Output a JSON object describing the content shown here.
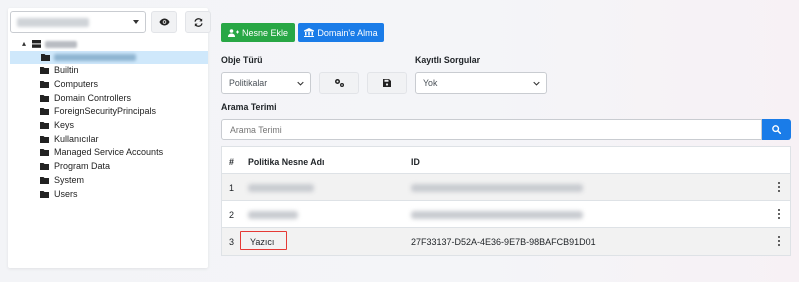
{
  "left_panel": {
    "tree": {
      "items": [
        "Builtin",
        "Computers",
        "Domain Controllers",
        "ForeignSecurityPrincipals",
        "Keys",
        "Kullanıcılar",
        "Managed Service Accounts",
        "Program Data",
        "System",
        "Users"
      ]
    }
  },
  "toolbar": {
    "add_object_label": "Nesne Ekle",
    "domain_label": "Domain'e Alma"
  },
  "filters": {
    "object_type_label": "Obje Türü",
    "object_type_value": "Politikalar",
    "saved_queries_label": "Kayıtlı Sorgular",
    "saved_queries_value": "Yok",
    "search_label": "Arama Terimi",
    "search_placeholder": "Arama Terimi"
  },
  "table": {
    "headers": {
      "num": "#",
      "name": "Politika Nesne Adı",
      "id": "ID"
    },
    "rows": [
      {
        "num": "1",
        "name": "",
        "id": ""
      },
      {
        "num": "2",
        "name": "",
        "id": ""
      },
      {
        "num": "3",
        "name": "Yazıcı",
        "id": "27F33137-D52A-4E36-9E7B-98BAFCB91D01"
      }
    ]
  },
  "colors": {
    "green": "#28a745",
    "blue": "#1a7ce8",
    "selected_row": "#cfe8fb",
    "highlight": "#e53935"
  },
  "icons": {
    "view": "eye-icon",
    "refresh": "refresh-icon",
    "add_user": "user-plus-icon",
    "domain": "building-icon",
    "settings": "cogs-icon",
    "save": "floppy-disk-icon",
    "search": "search-icon",
    "folder": "folder-icon",
    "server": "server-icon",
    "row_menu": "kebab-menu-icon"
  }
}
